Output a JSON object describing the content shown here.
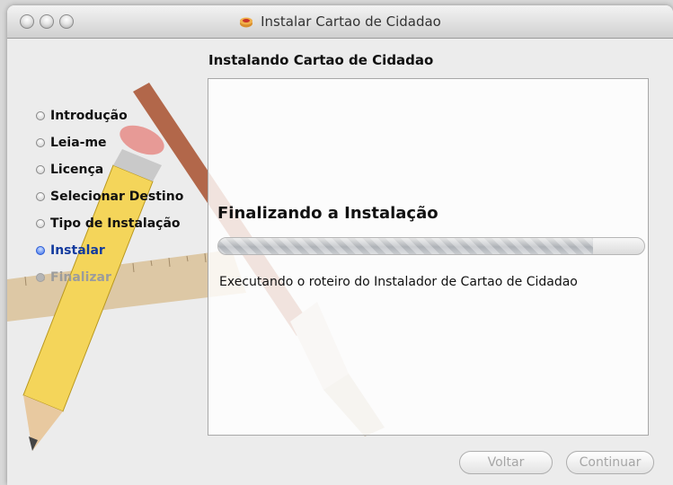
{
  "window": {
    "title": "Instalar Cartao de Cidadao",
    "app_icon": "package-icon"
  },
  "pane_title": "Instalando Cartao de Cidadao",
  "steps": [
    {
      "label": "Introdução",
      "state": "done"
    },
    {
      "label": "Leia-me",
      "state": "done"
    },
    {
      "label": "Licença",
      "state": "done"
    },
    {
      "label": "Selecionar Destino",
      "state": "done"
    },
    {
      "label": "Tipo de Instalação",
      "state": "done"
    },
    {
      "label": "Instalar",
      "state": "active"
    },
    {
      "label": "Finalizar",
      "state": "future"
    }
  ],
  "status": {
    "heading": "Finalizando a Instalação",
    "detail": "Executando o roteiro do Instalador de Cartao de Cidadao",
    "progress_fraction": 0.88
  },
  "buttons": {
    "back": "Voltar",
    "continue": "Continuar"
  },
  "colors": {
    "active_step": "#3a6ee8",
    "window_bg": "#ececec"
  }
}
